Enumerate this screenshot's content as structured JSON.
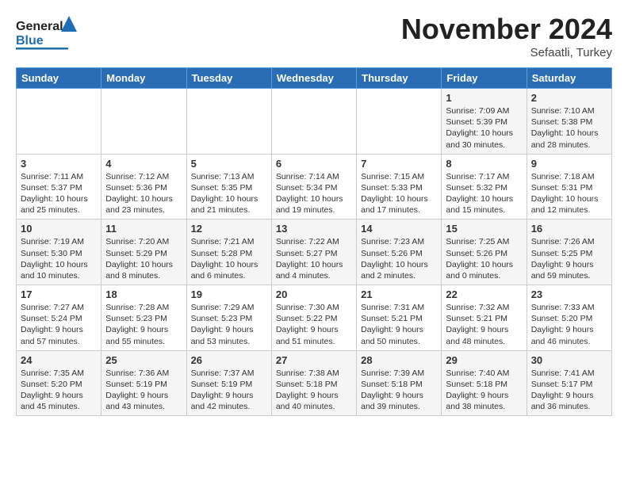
{
  "header": {
    "logo_line1": "General",
    "logo_line2": "Blue",
    "title": "November 2024",
    "subtitle": "Sefaatli, Turkey"
  },
  "weekdays": [
    "Sunday",
    "Monday",
    "Tuesday",
    "Wednesday",
    "Thursday",
    "Friday",
    "Saturday"
  ],
  "weeks": [
    [
      {
        "day": "",
        "content": ""
      },
      {
        "day": "",
        "content": ""
      },
      {
        "day": "",
        "content": ""
      },
      {
        "day": "",
        "content": ""
      },
      {
        "day": "",
        "content": ""
      },
      {
        "day": "1",
        "content": "Sunrise: 7:09 AM\nSunset: 5:39 PM\nDaylight: 10 hours and 30 minutes."
      },
      {
        "day": "2",
        "content": "Sunrise: 7:10 AM\nSunset: 5:38 PM\nDaylight: 10 hours and 28 minutes."
      }
    ],
    [
      {
        "day": "3",
        "content": "Sunrise: 7:11 AM\nSunset: 5:37 PM\nDaylight: 10 hours and 25 minutes."
      },
      {
        "day": "4",
        "content": "Sunrise: 7:12 AM\nSunset: 5:36 PM\nDaylight: 10 hours and 23 minutes."
      },
      {
        "day": "5",
        "content": "Sunrise: 7:13 AM\nSunset: 5:35 PM\nDaylight: 10 hours and 21 minutes."
      },
      {
        "day": "6",
        "content": "Sunrise: 7:14 AM\nSunset: 5:34 PM\nDaylight: 10 hours and 19 minutes."
      },
      {
        "day": "7",
        "content": "Sunrise: 7:15 AM\nSunset: 5:33 PM\nDaylight: 10 hours and 17 minutes."
      },
      {
        "day": "8",
        "content": "Sunrise: 7:17 AM\nSunset: 5:32 PM\nDaylight: 10 hours and 15 minutes."
      },
      {
        "day": "9",
        "content": "Sunrise: 7:18 AM\nSunset: 5:31 PM\nDaylight: 10 hours and 12 minutes."
      }
    ],
    [
      {
        "day": "10",
        "content": "Sunrise: 7:19 AM\nSunset: 5:30 PM\nDaylight: 10 hours and 10 minutes."
      },
      {
        "day": "11",
        "content": "Sunrise: 7:20 AM\nSunset: 5:29 PM\nDaylight: 10 hours and 8 minutes."
      },
      {
        "day": "12",
        "content": "Sunrise: 7:21 AM\nSunset: 5:28 PM\nDaylight: 10 hours and 6 minutes."
      },
      {
        "day": "13",
        "content": "Sunrise: 7:22 AM\nSunset: 5:27 PM\nDaylight: 10 hours and 4 minutes."
      },
      {
        "day": "14",
        "content": "Sunrise: 7:23 AM\nSunset: 5:26 PM\nDaylight: 10 hours and 2 minutes."
      },
      {
        "day": "15",
        "content": "Sunrise: 7:25 AM\nSunset: 5:26 PM\nDaylight: 10 hours and 0 minutes."
      },
      {
        "day": "16",
        "content": "Sunrise: 7:26 AM\nSunset: 5:25 PM\nDaylight: 9 hours and 59 minutes."
      }
    ],
    [
      {
        "day": "17",
        "content": "Sunrise: 7:27 AM\nSunset: 5:24 PM\nDaylight: 9 hours and 57 minutes."
      },
      {
        "day": "18",
        "content": "Sunrise: 7:28 AM\nSunset: 5:23 PM\nDaylight: 9 hours and 55 minutes."
      },
      {
        "day": "19",
        "content": "Sunrise: 7:29 AM\nSunset: 5:23 PM\nDaylight: 9 hours and 53 minutes."
      },
      {
        "day": "20",
        "content": "Sunrise: 7:30 AM\nSunset: 5:22 PM\nDaylight: 9 hours and 51 minutes."
      },
      {
        "day": "21",
        "content": "Sunrise: 7:31 AM\nSunset: 5:21 PM\nDaylight: 9 hours and 50 minutes."
      },
      {
        "day": "22",
        "content": "Sunrise: 7:32 AM\nSunset: 5:21 PM\nDaylight: 9 hours and 48 minutes."
      },
      {
        "day": "23",
        "content": "Sunrise: 7:33 AM\nSunset: 5:20 PM\nDaylight: 9 hours and 46 minutes."
      }
    ],
    [
      {
        "day": "24",
        "content": "Sunrise: 7:35 AM\nSunset: 5:20 PM\nDaylight: 9 hours and 45 minutes."
      },
      {
        "day": "25",
        "content": "Sunrise: 7:36 AM\nSunset: 5:19 PM\nDaylight: 9 hours and 43 minutes."
      },
      {
        "day": "26",
        "content": "Sunrise: 7:37 AM\nSunset: 5:19 PM\nDaylight: 9 hours and 42 minutes."
      },
      {
        "day": "27",
        "content": "Sunrise: 7:38 AM\nSunset: 5:18 PM\nDaylight: 9 hours and 40 minutes."
      },
      {
        "day": "28",
        "content": "Sunrise: 7:39 AM\nSunset: 5:18 PM\nDaylight: 9 hours and 39 minutes."
      },
      {
        "day": "29",
        "content": "Sunrise: 7:40 AM\nSunset: 5:18 PM\nDaylight: 9 hours and 38 minutes."
      },
      {
        "day": "30",
        "content": "Sunrise: 7:41 AM\nSunset: 5:17 PM\nDaylight: 9 hours and 36 minutes."
      }
    ]
  ]
}
